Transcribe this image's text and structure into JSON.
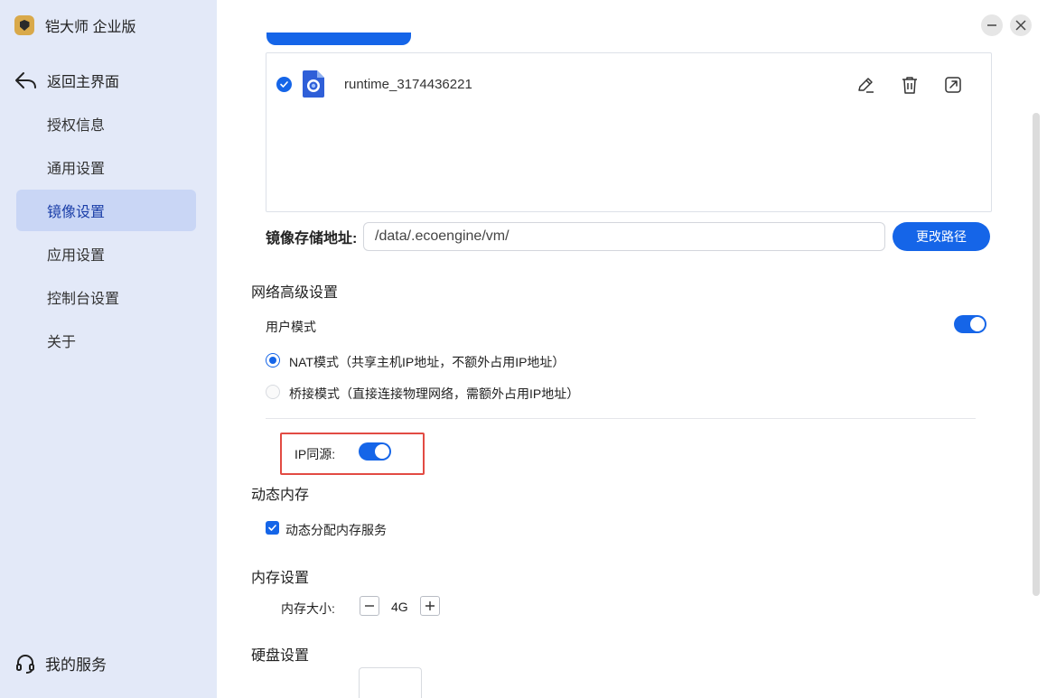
{
  "app": {
    "title": "铠大师 企业版"
  },
  "sidebar": {
    "back_label": "返回主界面",
    "items": [
      {
        "label": "授权信息",
        "active": false
      },
      {
        "label": "通用设置",
        "active": false
      },
      {
        "label": "镜像设置",
        "active": true
      },
      {
        "label": "应用设置",
        "active": false
      },
      {
        "label": "控制台设置",
        "active": false
      },
      {
        "label": "关于",
        "active": false
      }
    ],
    "service_label": "我的服务"
  },
  "image_list": {
    "items": [
      {
        "name": "runtime_3174436221",
        "selected": true
      }
    ]
  },
  "storage": {
    "label": "镜像存储地址:",
    "path": "/data/.ecoengine/vm/",
    "change_button": "更改路径"
  },
  "network": {
    "title": "网络高级设置",
    "user_mode_label": "用户模式",
    "user_mode_enabled": true,
    "nat_label": "NAT模式（共享主机IP地址，不额外占用IP地址）",
    "nat_selected": true,
    "bridge_label": "桥接模式（直接连接物理网络，需额外占用IP地址）",
    "bridge_selected": false,
    "ip_same_source_label": "IP同源:",
    "ip_same_source_enabled": true
  },
  "dynamic_memory": {
    "title": "动态内存",
    "checkbox_label": "动态分配内存服务",
    "checked": true
  },
  "memory": {
    "title": "内存设置",
    "size_label": "内存大小:",
    "size_value": "4G"
  },
  "disk": {
    "title": "硬盘设置"
  },
  "colors": {
    "accent": "#1565e8",
    "highlight": "#e24b43",
    "sidebar_bg": "#e3e9f8",
    "sidebar_active": "#c9d6f5"
  }
}
